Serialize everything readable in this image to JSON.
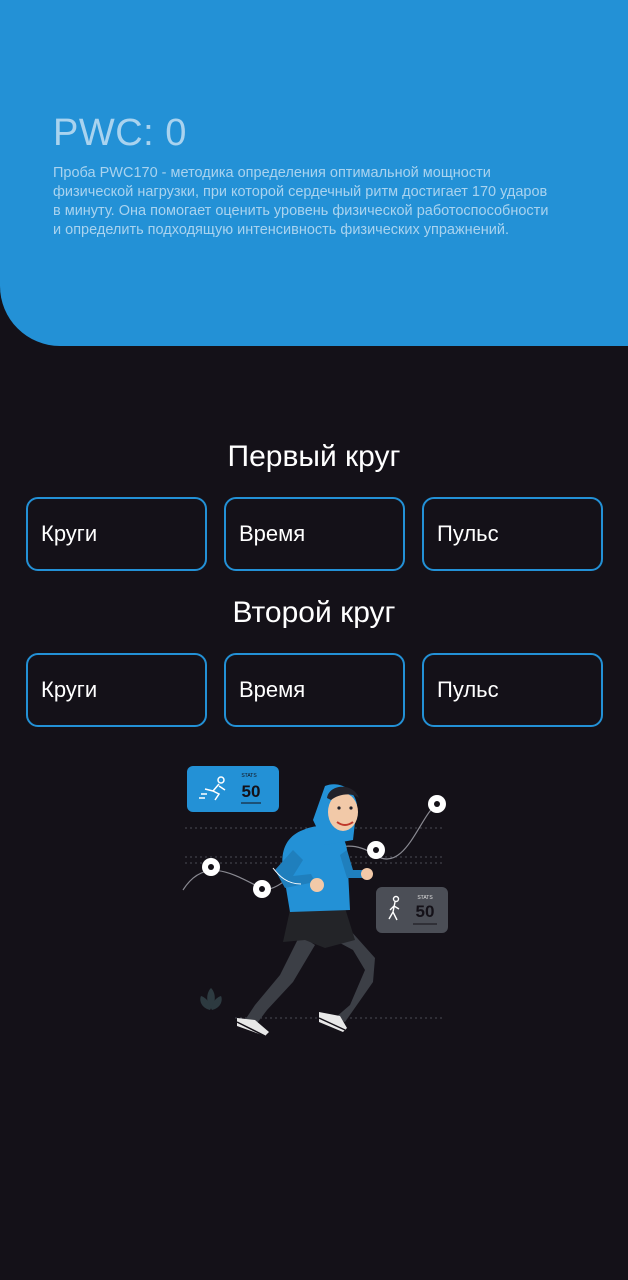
{
  "header": {
    "title": "PWC: 0",
    "description": "Проба PWC170 - методика определения оптимальной мощности физической нагрузки, при которой сердечный ритм достигает 170 ударов в минуту. Она помогает оценить уровень физической работоспособности и определить подходящую интенсивность физических упражнений."
  },
  "rounds": [
    {
      "title": "Первый круг",
      "fields": [
        {
          "placeholder": "Круги"
        },
        {
          "placeholder": "Время"
        },
        {
          "placeholder": "Пульс"
        }
      ]
    },
    {
      "title": "Второй круг",
      "fields": [
        {
          "placeholder": "Круги"
        },
        {
          "placeholder": "Время"
        },
        {
          "placeholder": "Пульс"
        }
      ]
    }
  ],
  "illustration": {
    "stats_label": "STATS",
    "stats_value_1": "50",
    "stats_value_2": "50"
  },
  "colors": {
    "accent": "#2391d6",
    "background": "#141118",
    "header_text": "#a9d3ef"
  }
}
